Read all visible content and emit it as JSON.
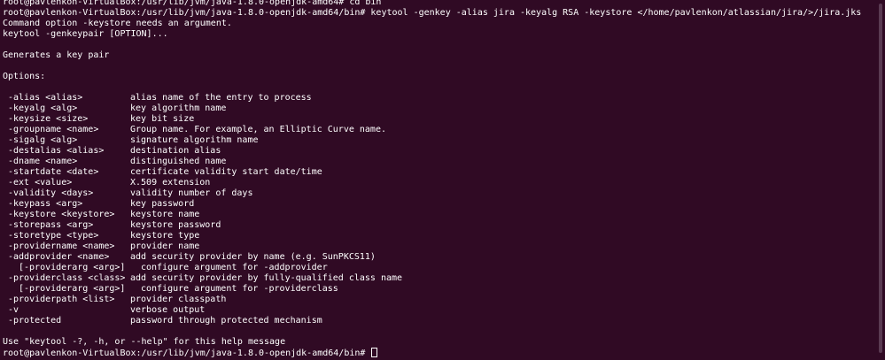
{
  "terminal": {
    "history": [
      "root@pavlenkon-VirtualBox:/usr/lib/jvm/java-1.8.0-openjdk-amd64# cd bin",
      "root@pavlenkon-VirtualBox:/usr/lib/jvm/java-1.8.0-openjdk-amd64/bin# keytool -genkey -alias jira -keyalg RSA -keystore </home/pavlenkon/atlassian/jira/>/jira.jks",
      "Command option -keystore needs an argument.",
      "keytool -genkeypair [OPTION]...",
      "",
      "Generates a key pair",
      "",
      "Options:",
      ""
    ],
    "options": [
      {
        "flag": "-alias <alias>",
        "desc": "alias name of the entry to process"
      },
      {
        "flag": "-keyalg <alg>",
        "desc": "key algorithm name"
      },
      {
        "flag": "-keysize <size>",
        "desc": "key bit size"
      },
      {
        "flag": "-groupname <name>",
        "desc": "Group name. For example, an Elliptic Curve name."
      },
      {
        "flag": "-sigalg <alg>",
        "desc": "signature algorithm name"
      },
      {
        "flag": "-destalias <alias>",
        "desc": "destination alias"
      },
      {
        "flag": "-dname <name>",
        "desc": "distinguished name"
      },
      {
        "flag": "-startdate <date>",
        "desc": "certificate validity start date/time"
      },
      {
        "flag": "-ext <value>",
        "desc": "X.509 extension"
      },
      {
        "flag": "-validity <days>",
        "desc": "validity number of days"
      },
      {
        "flag": "-keypass <arg>",
        "desc": "key password"
      },
      {
        "flag": "-keystore <keystore>",
        "desc": "keystore name"
      },
      {
        "flag": "-storepass <arg>",
        "desc": "keystore password"
      },
      {
        "flag": "-storetype <type>",
        "desc": "keystore type"
      },
      {
        "flag": "-providername <name>",
        "desc": "provider name"
      },
      {
        "flag": "-addprovider <name>",
        "desc": "add security provider by name (e.g. SunPKCS11)"
      },
      {
        "flag": "[-providerarg <arg>]",
        "desc": "configure argument for -addprovider",
        "sub": true
      },
      {
        "flag": "-providerclass <class>",
        "desc": "add security provider by fully-qualified class name"
      },
      {
        "flag": "[-providerarg <arg>]",
        "desc": "configure argument for -providerclass",
        "sub": true
      },
      {
        "flag": "-providerpath <list>",
        "desc": "provider classpath"
      },
      {
        "flag": "-v",
        "desc": "verbose output"
      },
      {
        "flag": "-protected",
        "desc": "password through protected mechanism"
      }
    ],
    "help_hint": "Use \"keytool -?, -h, or --help\" for this help message",
    "prompt": "root@pavlenkon-VirtualBox:/usr/lib/jvm/java-1.8.0-openjdk-amd64/bin# ",
    "colors": {
      "background": "#300a24",
      "foreground": "#ffffff"
    }
  }
}
